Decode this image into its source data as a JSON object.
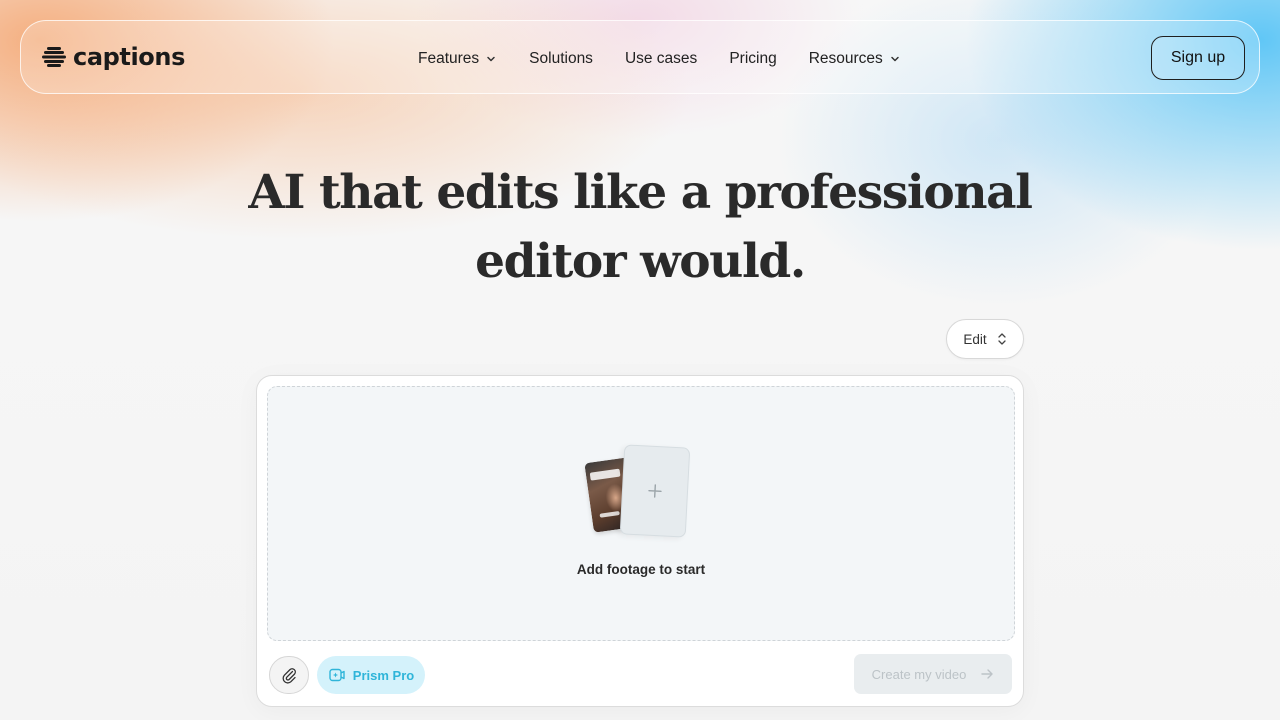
{
  "brand": {
    "name": "captions"
  },
  "nav": {
    "items": [
      {
        "label": "Features",
        "has_dropdown": true
      },
      {
        "label": "Solutions",
        "has_dropdown": false
      },
      {
        "label": "Use cases",
        "has_dropdown": false
      },
      {
        "label": "Pricing",
        "has_dropdown": false
      },
      {
        "label": "Resources",
        "has_dropdown": true
      }
    ],
    "signup_label": "Sign up"
  },
  "hero": {
    "line1": "AI that edits like a professional",
    "line2": "editor would."
  },
  "mode_selector": {
    "value": "Edit",
    "icon": "chevron-up-down-icon"
  },
  "composer": {
    "dropzone_label": "Add footage to start",
    "attach_icon": "paperclip-icon",
    "model_label": "Prism Pro",
    "model_icon": "prism-icon",
    "submit_label": "Create my video",
    "submit_icon": "arrow-right-icon",
    "submit_enabled": false
  },
  "colors": {
    "accent_cyan": "#2fb5d9",
    "accent_cyan_bg": "#d4f2fb",
    "text_dark": "#1b1b1b"
  }
}
